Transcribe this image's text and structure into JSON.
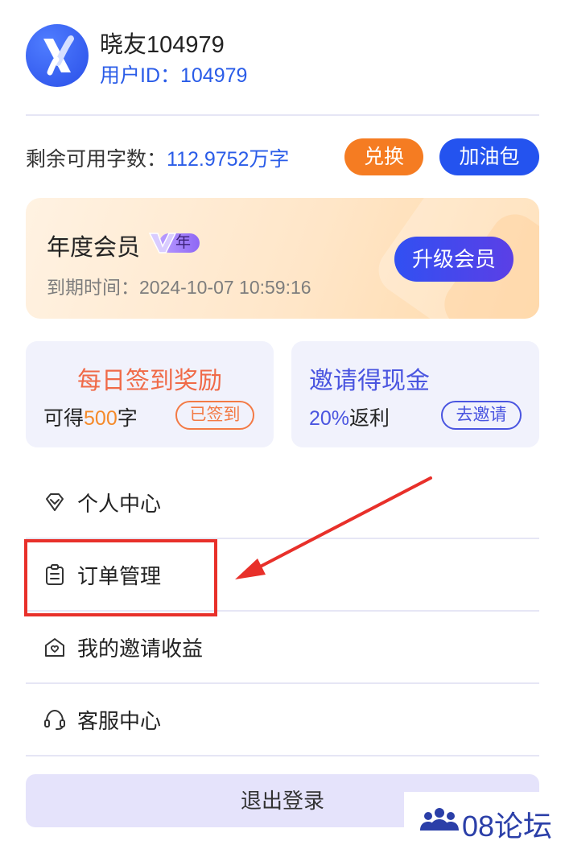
{
  "user": {
    "name": "晓友104979",
    "id_text": "用户ID：104979"
  },
  "balance": {
    "label": "剩余可用字数：",
    "value": "112.9752万字",
    "exchange_label": "兑换",
    "refuel_label": "加油包"
  },
  "membership": {
    "title": "年度会员",
    "badge_text": "年",
    "expire_text": "到期时间：2024-10-07 10:59:16",
    "upgrade_label": "升级会员"
  },
  "checkin": {
    "title": "每日签到奖励",
    "prefix": "可得",
    "amount": "500",
    "suffix": "字",
    "status_label": "已签到"
  },
  "invite": {
    "title": "邀请得现金",
    "percent": "20%",
    "suffix": "返利",
    "button_label": "去邀请"
  },
  "menu": [
    {
      "label": "个人中心",
      "icon": "diamond-icon"
    },
    {
      "label": "订单管理",
      "icon": "clipboard-icon"
    },
    {
      "label": "我的邀请收益",
      "icon": "envelope-heart-icon"
    },
    {
      "label": "客服中心",
      "icon": "headset-icon"
    }
  ],
  "logout_label": "退出登录",
  "watermark": "08论坛",
  "colors": {
    "accent_blue": "#2453ef",
    "accent_orange": "#f57c22",
    "highlight_red": "#e8302a"
  }
}
